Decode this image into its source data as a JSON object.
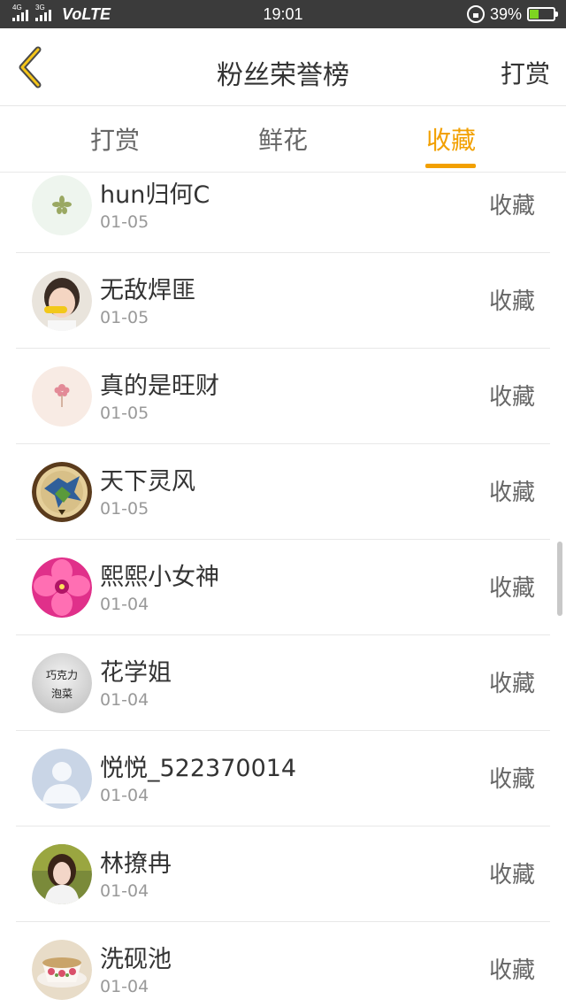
{
  "status_bar": {
    "net1": "4G",
    "net2": "3G",
    "volte": "VoLTE",
    "time": "19:01",
    "battery": "39%",
    "battery_level": 0.39
  },
  "header": {
    "title": "粉丝荣誉榜",
    "action": "打赏"
  },
  "tabs": [
    {
      "label": "打赏",
      "active": false
    },
    {
      "label": "鲜花",
      "active": false
    },
    {
      "label": "收藏",
      "active": true
    }
  ],
  "accent_color": "#f2a000",
  "rows": [
    {
      "name": "hun归何C",
      "date": "01-05",
      "action": "收藏",
      "avatar": "flower-sketch-avatar"
    },
    {
      "name": "无敌焊匪",
      "date": "01-05",
      "action": "收藏",
      "avatar": "child-photo-avatar"
    },
    {
      "name": "真的是旺财",
      "date": "01-05",
      "action": "收藏",
      "avatar": "pink-flower-avatar"
    },
    {
      "name": "天下灵风",
      "date": "01-05",
      "action": "收藏",
      "avatar": "dragon-badge-avatar"
    },
    {
      "name": "熙熙小女神",
      "date": "01-04",
      "action": "收藏",
      "avatar": "pink-bloom-avatar"
    },
    {
      "name": "花学姐",
      "date": "01-04",
      "action": "收藏",
      "avatar": "text-avatar",
      "avatar_text": [
        "巧克力",
        "泡菜"
      ]
    },
    {
      "name": "悦悦_522370014",
      "date": "01-04",
      "action": "收藏",
      "avatar": "default-user-avatar"
    },
    {
      "name": "林撩冉",
      "date": "01-04",
      "action": "收藏",
      "avatar": "girl-photo-avatar"
    },
    {
      "name": "洗砚池",
      "date": "01-04",
      "action": "收藏",
      "avatar": "teacup-avatar"
    }
  ]
}
